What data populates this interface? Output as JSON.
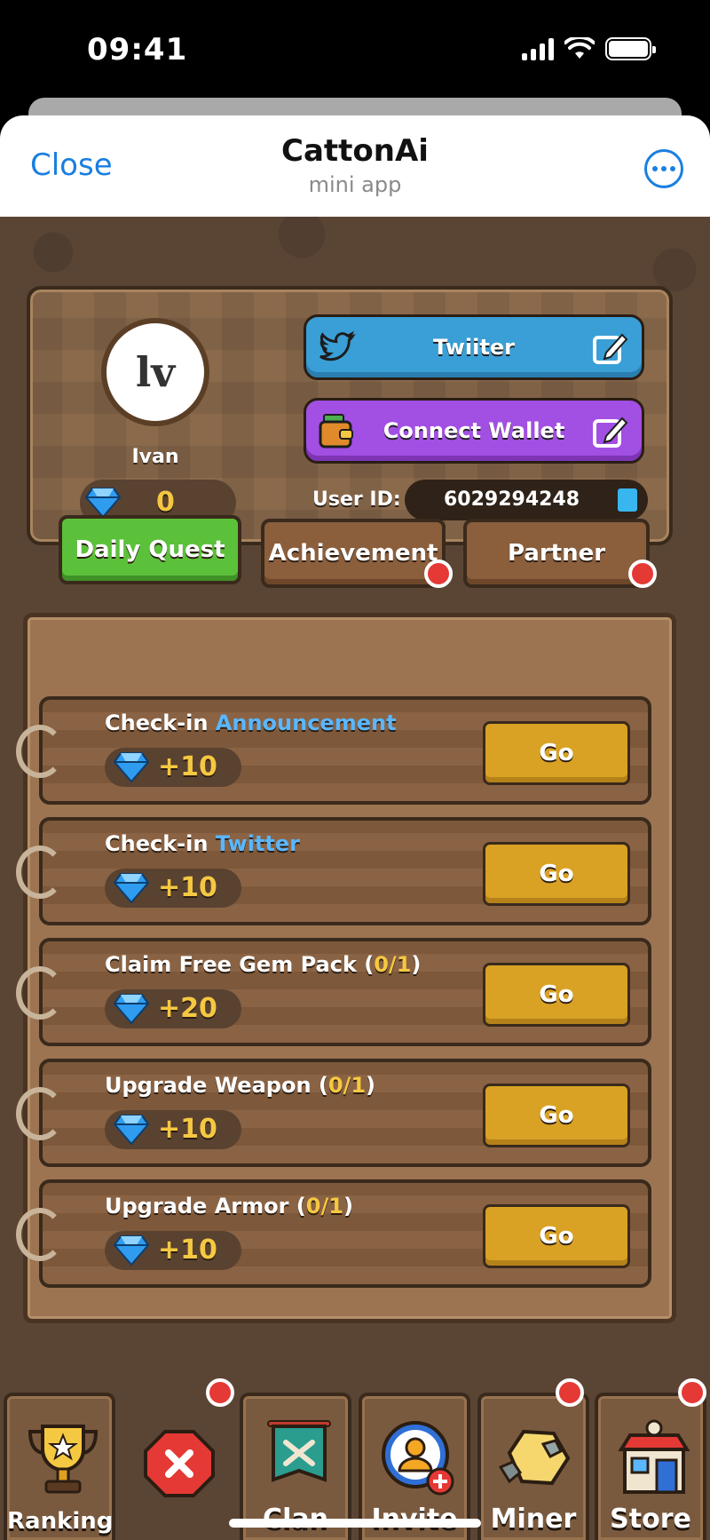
{
  "status_bar": {
    "time": "09:41"
  },
  "header": {
    "close_label": "Close",
    "title": "CattonAi",
    "subtitle": "mini app"
  },
  "profile": {
    "avatar_initials": "lv",
    "username": "Ivan",
    "gems": "0",
    "twitter_label": "Twiiter",
    "wallet_label": "Connect Wallet",
    "user_id_label": "User ID:",
    "user_id": "6029294248"
  },
  "tabs": [
    {
      "label": "Daily Quest",
      "active": true,
      "badge": false
    },
    {
      "label": "Achievement",
      "active": false,
      "badge": true
    },
    {
      "label": "Partner",
      "active": false,
      "badge": true
    }
  ],
  "quests": [
    {
      "prefix": "Check-in ",
      "highlight": "Announcement",
      "reward": "+10",
      "action": "Go"
    },
    {
      "prefix": "Check-in ",
      "highlight": "Twitter",
      "reward": "+10",
      "action": "Go"
    },
    {
      "prefix": "Claim Free Gem Pack (",
      "progress": "0/1",
      "suffix": ")",
      "reward": "+20",
      "action": "Go"
    },
    {
      "prefix": "Upgrade Weapon (",
      "progress": "0/1",
      "suffix": ")",
      "reward": "+10",
      "action": "Go"
    },
    {
      "prefix": "Upgrade Armor (",
      "progress": "0/1",
      "suffix": ")",
      "reward": "+10",
      "action": "Go"
    }
  ],
  "nav": [
    {
      "label": "Ranking",
      "icon": "trophy-icon",
      "badge": false
    },
    {
      "label": "Clan",
      "icon": "clan-banner-icon",
      "badge": false
    },
    {
      "label": "Invite",
      "icon": "invite-user-icon",
      "badge": false
    },
    {
      "label": "Miner",
      "icon": "gold-ore-icon",
      "badge": true
    },
    {
      "label": "Store",
      "icon": "paw-store-icon",
      "badge": true
    }
  ],
  "colors": {
    "accent_blue": "#1a7fe0",
    "twitter": "#3a9fd6",
    "wallet": "#a24fe3",
    "active_tab": "#5cc13a",
    "go_button": "#d9a224",
    "gold_text": "#f5c842",
    "badge_red": "#e53935"
  }
}
